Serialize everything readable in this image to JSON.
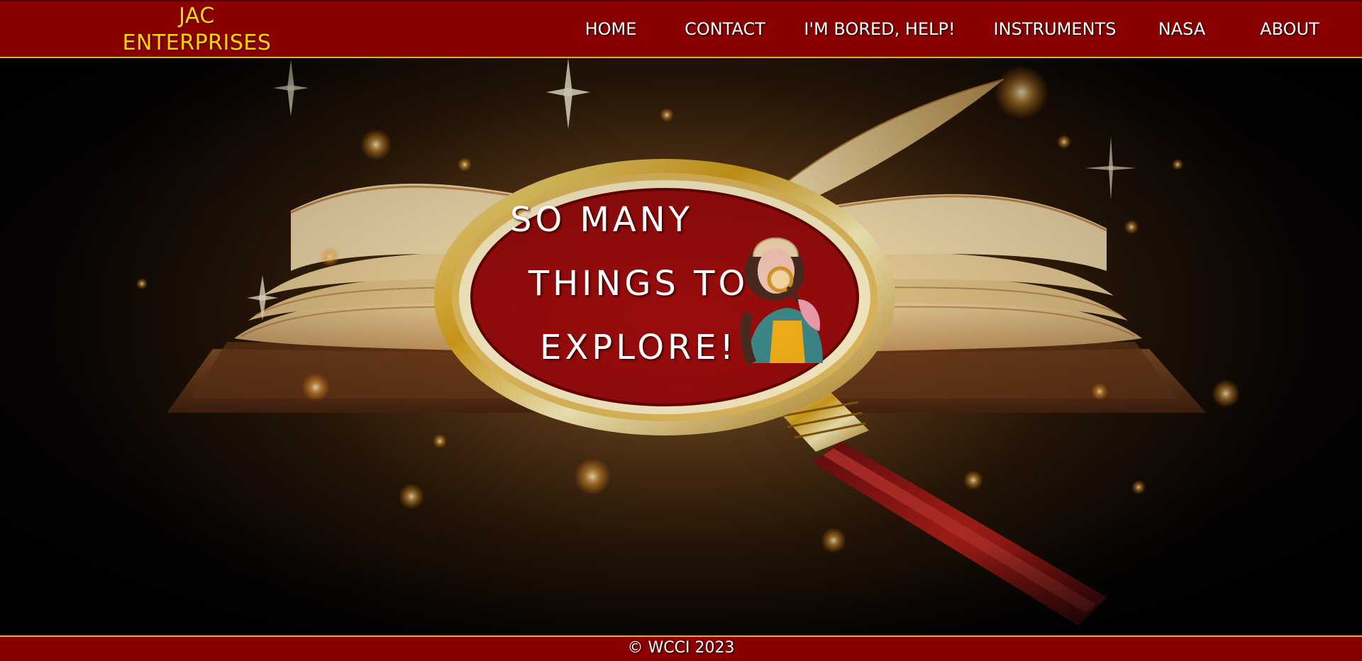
{
  "brand": {
    "line1": "JAC",
    "line2": "ENTERPRISES"
  },
  "nav": {
    "items": [
      {
        "label": "HOME"
      },
      {
        "label": "CONTACT"
      },
      {
        "label": "I'M BORED, HELP!"
      },
      {
        "label": "INSTRUMENTS"
      },
      {
        "label": "NASA"
      },
      {
        "label": "ABOUT"
      }
    ]
  },
  "hero": {
    "headline": {
      "line1": "SO MANY",
      "line2": "THINGS TO",
      "line3": "EXPLORE!"
    }
  },
  "footer": {
    "copyright": "© WCCI 2023"
  },
  "colors": {
    "header_bg": "#8a0000",
    "brand_text": "#ffd700",
    "gold_border": "#d8b23a",
    "lens_fill": "#9a0c0c"
  }
}
